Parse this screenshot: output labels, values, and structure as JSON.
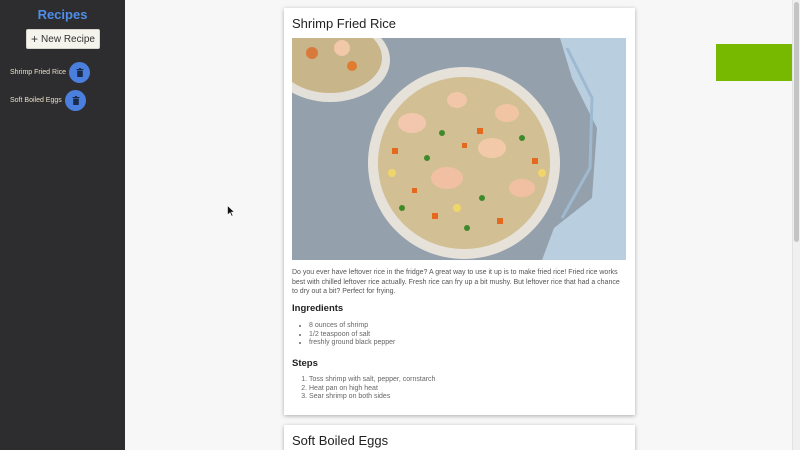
{
  "sidebar": {
    "title": "Recipes",
    "new_button_label": "New Recipe",
    "items": [
      {
        "label": "Shrimp Fried Rice"
      },
      {
        "label": "Soft Boiled Eggs"
      }
    ]
  },
  "recipes": [
    {
      "title": "Shrimp Fried Rice",
      "description": "Do you ever have leftover rice in the fridge? A great way to use it up is to make fried rice! Fried rice works best with chilled leftover rice actually. Fresh rice can fry up a bit mushy. But leftover rice that had a chance to dry out a bit? Perfect for frying.",
      "ingredients_heading": "Ingredients",
      "ingredients": [
        "8 ounces of shrimp",
        "1/2 teaspoon of salt",
        "freshly ground black pepper"
      ],
      "steps_heading": "Steps",
      "steps": [
        "Toss shrimp with salt, pepper, cornstarch",
        "Heat pan on high heat",
        "Sear shrimp on both sides"
      ]
    },
    {
      "title": "Soft Boiled Eggs"
    }
  ],
  "colors": {
    "sidebar_bg": "#2d2d30",
    "accent_blue": "#4a7fde",
    "green_block": "#76b900"
  }
}
